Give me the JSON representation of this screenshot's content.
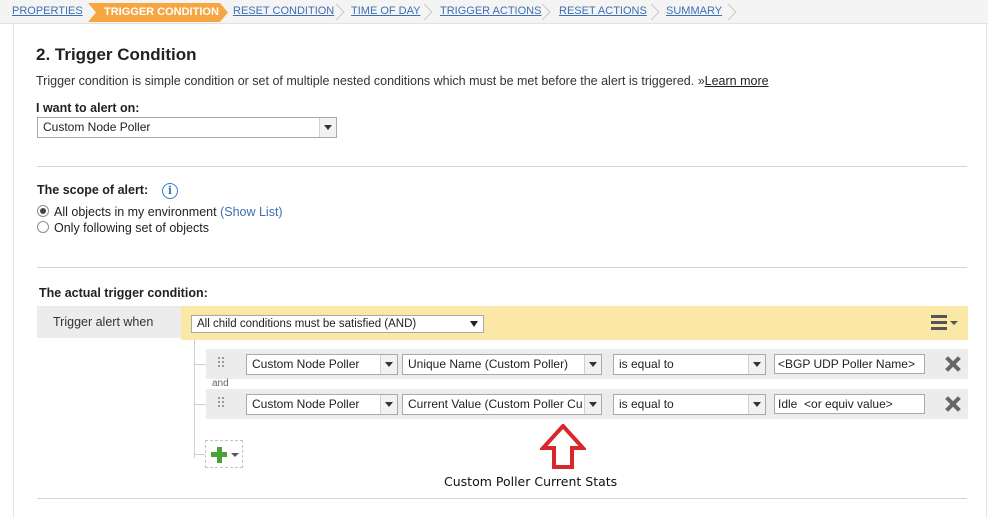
{
  "wizard": {
    "steps": [
      {
        "label": "PROPERTIES",
        "active": false
      },
      {
        "label": "TRIGGER CONDITION",
        "active": true
      },
      {
        "label": "RESET CONDITION",
        "active": false
      },
      {
        "label": "TIME OF DAY",
        "active": false
      },
      {
        "label": "TRIGGER ACTIONS",
        "active": false
      },
      {
        "label": "RESET ACTIONS",
        "active": false
      },
      {
        "label": "SUMMARY",
        "active": false
      }
    ]
  },
  "section": {
    "title": "2. Trigger Condition",
    "description": "Trigger condition is simple condition or set of multiple nested conditions which must be met before the alert is triggered.",
    "learn_more_prefix": "»",
    "learn_more": "Learn more"
  },
  "alert_on": {
    "label": "I want to alert on:",
    "value": "Custom Node Poller"
  },
  "scope": {
    "label": "The scope of alert:",
    "info_icon": "info-icon",
    "options": [
      {
        "label": "All objects in my environment",
        "link": "(Show List)",
        "checked": true
      },
      {
        "label": "Only following set of objects",
        "link": "",
        "checked": false
      }
    ]
  },
  "trigger": {
    "label": "The actual trigger condition:",
    "when_label": "Trigger alert when",
    "group_value": "All child conditions must be satisfied (AND)",
    "and_label": "and",
    "conditions": [
      {
        "object": "Custom Node Poller",
        "field": "Unique Name (Custom Poller)",
        "operator": "is equal to",
        "value": "<BGP UDP Poller Name>"
      },
      {
        "object": "Custom Node Poller",
        "field": "Current Value (Custom Poller Current Stats)",
        "operator": "is equal to",
        "value": "Idle  <or equiv value>"
      }
    ]
  },
  "annotation": {
    "text": "Custom Poller Current Stats",
    "color": "#d9262b"
  },
  "colors": {
    "active_step": "#f5a640",
    "link": "#3e6fb4",
    "group_bar": "#fbe8a6",
    "add_icon": "#4aa23a"
  }
}
